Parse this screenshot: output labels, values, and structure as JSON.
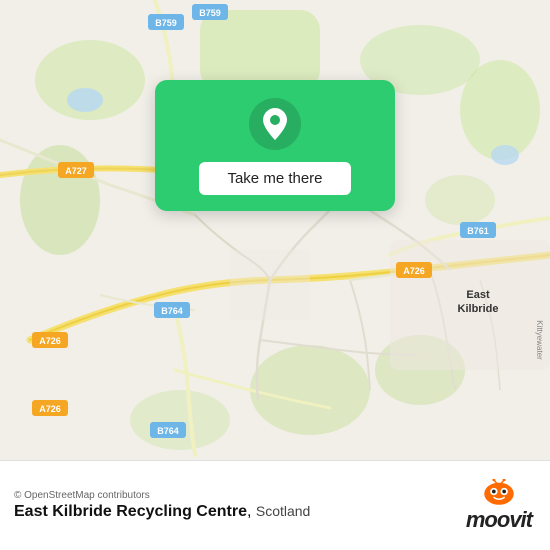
{
  "map": {
    "background_color": "#f2efe9",
    "alt": "Map of East Kilbride area, Scotland"
  },
  "cta": {
    "button_label": "Take me there",
    "pin_color": "#2ecc71"
  },
  "footer": {
    "attribution": "© OpenStreetMap contributors",
    "place_name": "East Kilbride Recycling Centre",
    "place_region": "Scotland",
    "logo_text": "moovit"
  },
  "road_labels": [
    {
      "id": "B759_top",
      "text": "B759"
    },
    {
      "id": "A727",
      "text": "A727"
    },
    {
      "id": "A726_left",
      "text": "A726"
    },
    {
      "id": "A726_bottom",
      "text": "A726"
    },
    {
      "id": "B764_mid",
      "text": "B764"
    },
    {
      "id": "B764_bot",
      "text": "B764"
    },
    {
      "id": "A726_right",
      "text": "A726"
    },
    {
      "id": "B761",
      "text": "B761"
    },
    {
      "id": "B759_right",
      "text": "B759"
    }
  ],
  "place_labels": [
    {
      "id": "east_kilbride",
      "text": "East\nKilbride"
    }
  ]
}
